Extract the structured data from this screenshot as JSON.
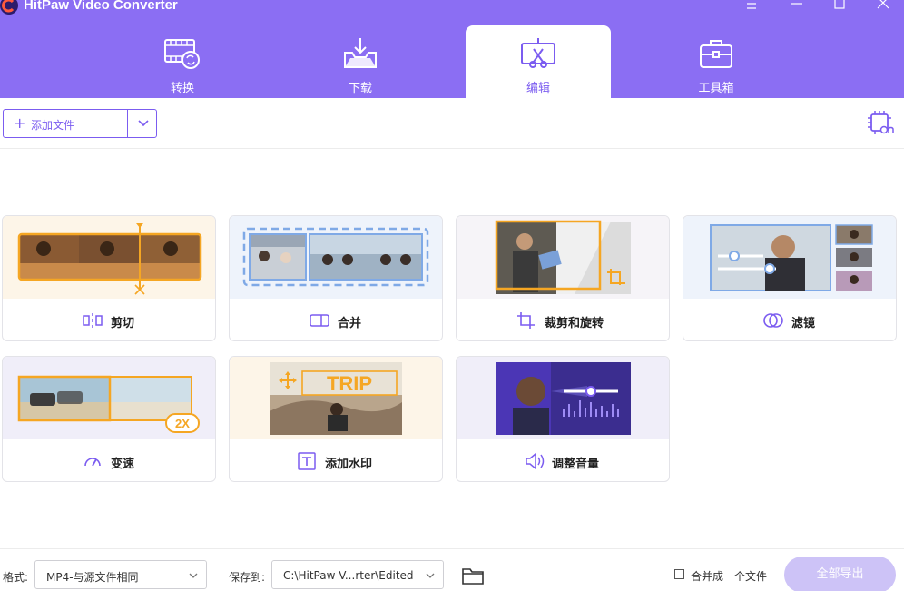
{
  "app": {
    "title": "HitPaw Video Converter"
  },
  "colors": {
    "accent": "#7b5cf0",
    "header_bg": "#8b6ef3",
    "orange": "#f5a623",
    "export_disabled": "#cdc3f7"
  },
  "tabs": [
    {
      "label": "转换",
      "icon": "convert-icon",
      "active": false
    },
    {
      "label": "下载",
      "icon": "download-icon",
      "active": false
    },
    {
      "label": "编辑",
      "icon": "edit-icon",
      "active": true
    },
    {
      "label": "工具箱",
      "icon": "toolbox-icon",
      "active": false
    }
  ],
  "toolbar": {
    "add_file_label": "添加文件"
  },
  "cards": [
    {
      "label": "剪切",
      "icon": "cut-icon"
    },
    {
      "label": "合并",
      "icon": "merge-icon"
    },
    {
      "label": "裁剪和旋转",
      "icon": "crop-rotate-icon"
    },
    {
      "label": "滤镜",
      "icon": "filter-icon"
    },
    {
      "label": "变速",
      "icon": "speed-icon",
      "badge": "2X"
    },
    {
      "label": "添加水印",
      "icon": "watermark-icon",
      "thumb_text": "TRIP"
    },
    {
      "label": "调整音量",
      "icon": "volume-icon"
    }
  ],
  "bottom": {
    "format_label": "格式:",
    "format_value": "MP4-与源文件相同",
    "save_label": "保存到:",
    "save_path": "C:\\HitPaw V...rter\\Edited",
    "merge_label": "合并成一个文件",
    "merge_checked": false,
    "export_label": "全部导出"
  }
}
